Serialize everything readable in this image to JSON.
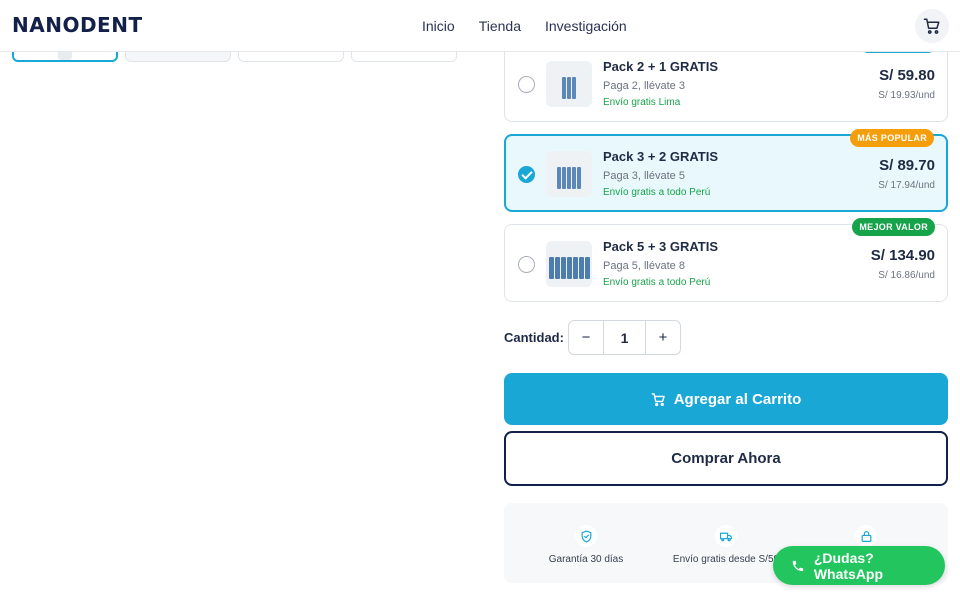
{
  "brand": "NANODENT",
  "nav": {
    "items": [
      "Inicio",
      "Tienda",
      "Investigación"
    ]
  },
  "options": [
    {
      "name": "Pack 2 + 1 GRATIS",
      "desc": "Paga 2, llévate 3",
      "shipping": "Envío gratis Lima",
      "price": "S/ 59.80",
      "unit": "S/ 19.93/und",
      "badge": "",
      "selected": false
    },
    {
      "name": "Pack 3 + 2 GRATIS",
      "desc": "Paga 3, llévate 5",
      "shipping": "Envío gratis a todo Perú",
      "price": "S/ 89.70",
      "unit": "S/ 17.94/und",
      "badge": "MÁS POPULAR",
      "selected": true
    },
    {
      "name": "Pack 5 + 3 GRATIS",
      "desc": "Paga 5, llévate 8",
      "shipping": "Envío gratis a todo Perú",
      "price": "S/ 134.90",
      "unit": "S/ 16.86/und",
      "badge": "MEJOR VALOR",
      "selected": false
    }
  ],
  "quantity": {
    "label": "Cantidad:",
    "value": "1",
    "minus": "−",
    "plus": "+"
  },
  "buttons": {
    "add_to_cart": "Agregar al Carrito",
    "buy_now": "Comprar Ahora"
  },
  "features": [
    "Garantía 30 días",
    "Envío gratis desde S/59",
    ""
  ],
  "whatsapp": "¿Dudas? WhatsApp",
  "colors": {
    "accent": "#19a7d6",
    "navy": "#12204a",
    "popular_badge": "#f59e0b",
    "value_badge": "#16a34a",
    "whatsapp": "#22c55e",
    "ship_text": "#16a34a"
  },
  "icons": {
    "cart": "cart-icon",
    "shield": "shield-check-icon",
    "truck": "truck-icon",
    "lock": "lock-icon",
    "phone": "phone-icon",
    "check": "check-icon"
  }
}
